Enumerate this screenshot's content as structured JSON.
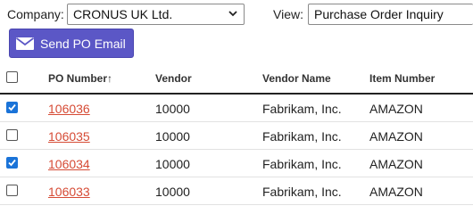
{
  "toolbar": {
    "company_label": "Company:",
    "company_value": "CRONUS UK Ltd.",
    "view_label": "View:",
    "view_value": "Purchase Order Inquiry",
    "send_button": "Send PO Email"
  },
  "grid": {
    "columns": [
      "PO Number",
      "Vendor",
      "Vendor Name",
      "Item Number"
    ],
    "sort_indicator": "↑",
    "header_checkbox_checked": false,
    "rows": [
      {
        "checked": true,
        "po": "106036",
        "vendor": "10000",
        "vendor_name": "Fabrikam, Inc.",
        "item": "AMAZON"
      },
      {
        "checked": false,
        "po": "106035",
        "vendor": "10000",
        "vendor_name": "Fabrikam, Inc.",
        "item": "AMAZON"
      },
      {
        "checked": true,
        "po": "106034",
        "vendor": "10000",
        "vendor_name": "Fabrikam, Inc.",
        "item": "AMAZON"
      },
      {
        "checked": false,
        "po": "106033",
        "vendor": "10000",
        "vendor_name": "Fabrikam, Inc.",
        "item": "AMAZON"
      }
    ]
  },
  "colors": {
    "accent": "#5b57c6",
    "link": "#d64b35",
    "checkbox_checked": "#1a73d8"
  },
  "icons": {
    "send_button_icon": "envelope-icon",
    "select_arrow": "chevron-down-icon"
  }
}
